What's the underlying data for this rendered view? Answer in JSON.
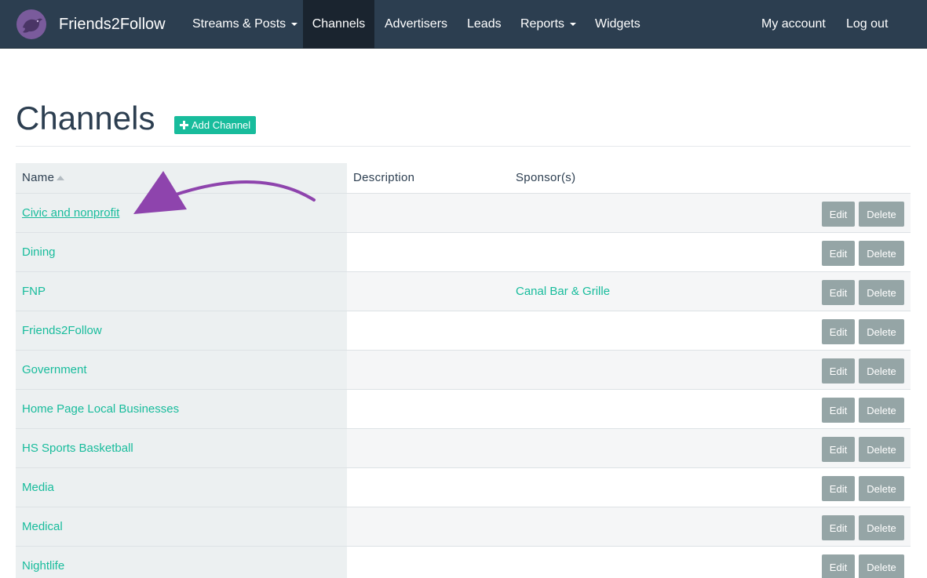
{
  "navbar": {
    "brand": "Friends2Follow",
    "logo_icon": "purple-bird-logo",
    "items": [
      {
        "label": "Streams & Posts",
        "dropdown": true,
        "active": false
      },
      {
        "label": "Channels",
        "dropdown": false,
        "active": true
      },
      {
        "label": "Advertisers",
        "dropdown": false,
        "active": false
      },
      {
        "label": "Leads",
        "dropdown": false,
        "active": false
      },
      {
        "label": "Reports",
        "dropdown": true,
        "active": false
      },
      {
        "label": "Widgets",
        "dropdown": false,
        "active": false
      }
    ],
    "right_items": [
      {
        "label": "My account"
      },
      {
        "label": "Log out"
      }
    ]
  },
  "page": {
    "title": "Channels",
    "add_button_label": "Add Channel"
  },
  "table": {
    "columns": [
      "Name",
      "Description",
      "Sponsor(s)"
    ],
    "edit_label": "Edit",
    "delete_label": "Delete",
    "rows": [
      {
        "name": "Civic and nonprofit",
        "description": "",
        "sponsors": ""
      },
      {
        "name": "Dining",
        "description": "",
        "sponsors": ""
      },
      {
        "name": "FNP",
        "description": "",
        "sponsors": "Canal Bar & Grille"
      },
      {
        "name": "Friends2Follow",
        "description": "",
        "sponsors": ""
      },
      {
        "name": "Government",
        "description": "",
        "sponsors": ""
      },
      {
        "name": "Home Page Local Businesses",
        "description": "",
        "sponsors": ""
      },
      {
        "name": "HS Sports Basketball",
        "description": "",
        "sponsors": ""
      },
      {
        "name": "Media",
        "description": "",
        "sponsors": ""
      },
      {
        "name": "Medical",
        "description": "",
        "sponsors": ""
      },
      {
        "name": "Nightlife",
        "description": "",
        "sponsors": ""
      }
    ]
  },
  "colors": {
    "navbar_bg": "#2c3e50",
    "accent": "#18bc9c",
    "button_gray": "#95a5a6",
    "annotation_arrow": "#8e44ad"
  }
}
